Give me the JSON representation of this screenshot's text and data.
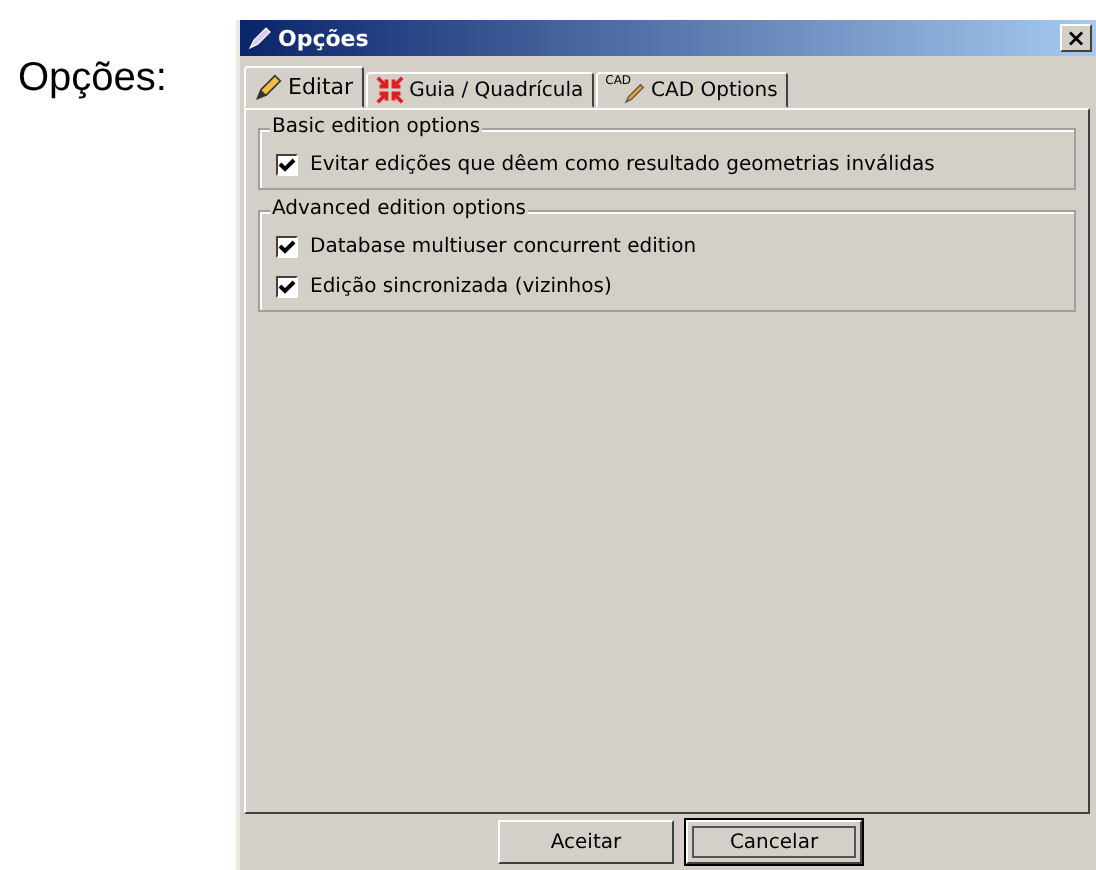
{
  "caption": "Opções:",
  "window": {
    "title": "Opções",
    "close": "×"
  },
  "tabs": [
    {
      "kind": "pencil",
      "label": "Editar",
      "selected": true
    },
    {
      "kind": "grid",
      "label": "Guia / Quadrícula",
      "selected": false
    },
    {
      "kind": "cad",
      "icon_text": "CAD",
      "label": "CAD Options",
      "selected": false
    }
  ],
  "groups": [
    {
      "title": "Basic edition options",
      "options": [
        {
          "label": "Evitar edições que dêem como resultado geometrias inválidas",
          "checked": true
        }
      ]
    },
    {
      "title": "Advanced edition options",
      "options": [
        {
          "label": "Database multiuser concurrent edition",
          "checked": true
        },
        {
          "label": "Edição sincronizada (vizinhos)",
          "checked": true
        }
      ]
    }
  ],
  "buttons": [
    {
      "label": "Aceitar",
      "focused": false
    },
    {
      "label": "Cancelar",
      "focused": true
    }
  ]
}
